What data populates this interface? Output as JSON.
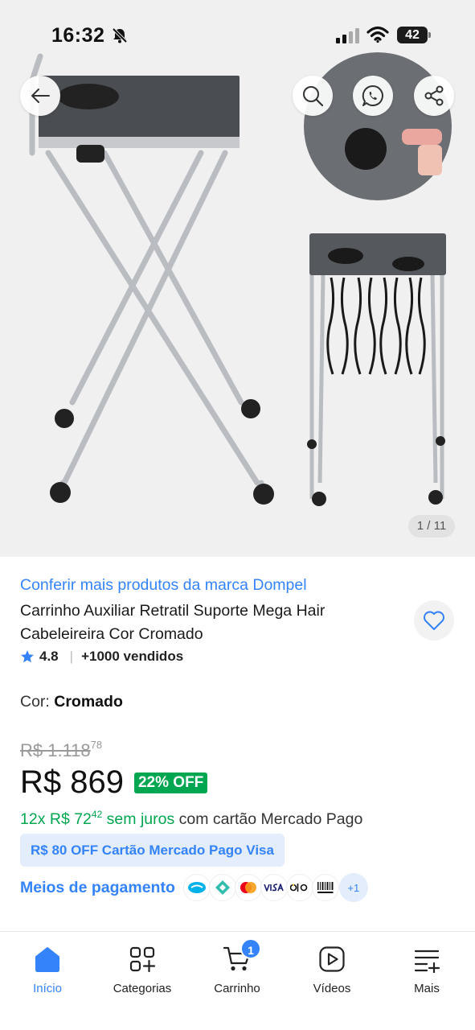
{
  "status_bar": {
    "time": "16:32",
    "battery": "42"
  },
  "gallery": {
    "counter": "1 / 11"
  },
  "product": {
    "brand_link": "Conferir mais produtos da marca Dompel",
    "title": "Carrinho Auxiliar Retratil Suporte Mega Hair Cabeleireira Cor Cromado",
    "rating": "4.8",
    "sold": "+1000 vendidos",
    "color_label": "Cor: ",
    "color_value": "Cromado",
    "old_price": "R$ 1.118",
    "old_price_cents": "78",
    "price": "R$ 869",
    "discount": "22% OFF",
    "installments_prefix": "12x R$ 72",
    "installments_cents": "42",
    "installments_suffix": " sem juros",
    "installments_card": " com cartão Mercado Pago",
    "promo": "R$ 80 OFF Cartão Mercado Pago Visa",
    "payments_label": "Meios de pagamento",
    "payments_more": "+1",
    "payment_icons": [
      "mercado-pago-icon",
      "pix-icon",
      "mastercard-icon",
      "visa-icon",
      "elo-icon",
      "boleto-icon"
    ]
  },
  "bottom_nav": {
    "items": [
      {
        "label": "Início",
        "icon": "home-icon",
        "active": true
      },
      {
        "label": "Categorias",
        "icon": "categories-icon"
      },
      {
        "label": "Carrinho",
        "icon": "cart-icon",
        "badge": "1"
      },
      {
        "label": "Vídeos",
        "icon": "play-icon"
      },
      {
        "label": "Mais",
        "icon": "menu-plus-icon"
      }
    ]
  },
  "colors": {
    "accent": "#3483fa",
    "success": "#00a650",
    "badge_bg": "#e3edfb"
  }
}
